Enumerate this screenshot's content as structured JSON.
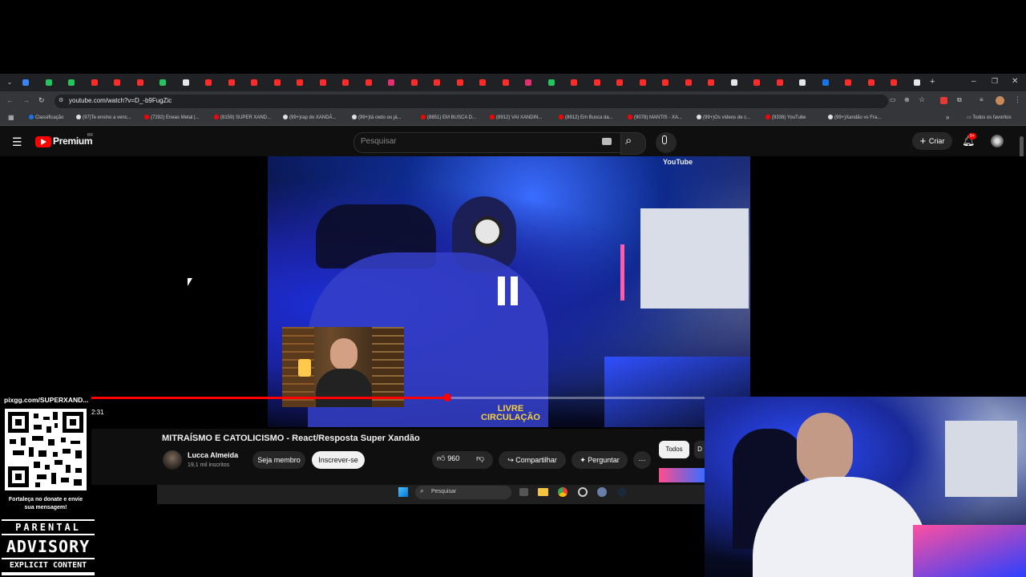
{
  "browser": {
    "url": "youtube.com/watch?v=D_-b9FugZic",
    "bookmarks": [
      {
        "label": "Classificação",
        "color": "#1a73e8"
      },
      {
        "label": "(97)Te ensino a venc...",
        "color": "#e0e0e0"
      },
      {
        "label": "(7292) Eneas Metal |...",
        "color": "#ff0000"
      },
      {
        "label": "(8159) SUPER XAND...",
        "color": "#ff0000"
      },
      {
        "label": "(99+)rap do XANDÃ...",
        "color": "#e0e0e0"
      },
      {
        "label": "(99+)tá cedo ou já...",
        "color": "#e0e0e0"
      },
      {
        "label": "(8851) EM BUSCA D...",
        "color": "#ff0000"
      },
      {
        "label": "(8912) VAI XANDIN...",
        "color": "#ff0000"
      },
      {
        "label": "(8912) Em Busca da...",
        "color": "#ff0000"
      },
      {
        "label": "(9078) MANTIS - XA...",
        "color": "#ff0000"
      },
      {
        "label": "(99+)Os vídeos de c...",
        "color": "#e0e0e0"
      },
      {
        "label": "(9338) YouTube",
        "color": "#ff0000"
      },
      {
        "label": "(99+)Xandão vs Fra...",
        "color": "#e0e0e0"
      }
    ],
    "all_bookmarks": "Todos os favoritos"
  },
  "youtube": {
    "logo_text": "Premium",
    "region": "BR",
    "search_placeholder": "Pesquisar",
    "create_label": "Criar",
    "notif_badge": "9+",
    "video_watermark": "YouTube",
    "time": "2:31",
    "progress_fraction": 0.54,
    "title": "MITRAÍSMO E CATOLICISMO - React/Resposta Super Xandão",
    "channel": "Lucca Almeida",
    "subscribers": "19,1 mil inscritos",
    "member_label": "Seja membro",
    "subscribe_label": "Inscrever-se",
    "likes": "960",
    "share_label": "Compartilhar",
    "ask_label": "Perguntar",
    "chip_all": "Todos",
    "chip_next": "D",
    "video_overlay": "LIVRE\nCIRCULAÇÃO"
  },
  "taskbar": {
    "search": "Pesquisar"
  },
  "overlay": {
    "qr_url": "pixgg.com/SUPERXAND...",
    "qr_caption": "Fortaleça no donate e envie sua mensagem!",
    "advisory_top": "PARENTAL",
    "advisory_mid": "ADVISORY",
    "advisory_bottom": "EXPLICIT CONTENT"
  },
  "colors": {
    "accent": "#ff0000",
    "tab_favicons": [
      "#3b82f6",
      "#22c55e",
      "#22c55e",
      "#ff2a2a",
      "#ff2a2a",
      "#ff2a2a",
      "#22c55e",
      "#e5e5e5",
      "#ff2a2a",
      "#ff2a2a",
      "#ff2a2a",
      "#ff2a2a",
      "#ff2a2a",
      "#ff2a2a",
      "#ff2a2a",
      "#ff2a2a",
      "#e1306c",
      "#ff2a2a",
      "#ff2a2a",
      "#ff2a2a",
      "#ff2a2a",
      "#ff2a2a",
      "#e1306c",
      "#22c55e",
      "#ff2a2a",
      "#ff2a2a",
      "#ff2a2a",
      "#ff2a2a",
      "#ff2a2a",
      "#ff2a2a",
      "#ff2a2a",
      "#e5e5e5",
      "#ff2a2a",
      "#ff2a2a",
      "#e5e5e5",
      "#1a73e8",
      "#ff2a2a",
      "#ff2a2a",
      "#ff2a2a",
      "#e5e5e5"
    ]
  }
}
